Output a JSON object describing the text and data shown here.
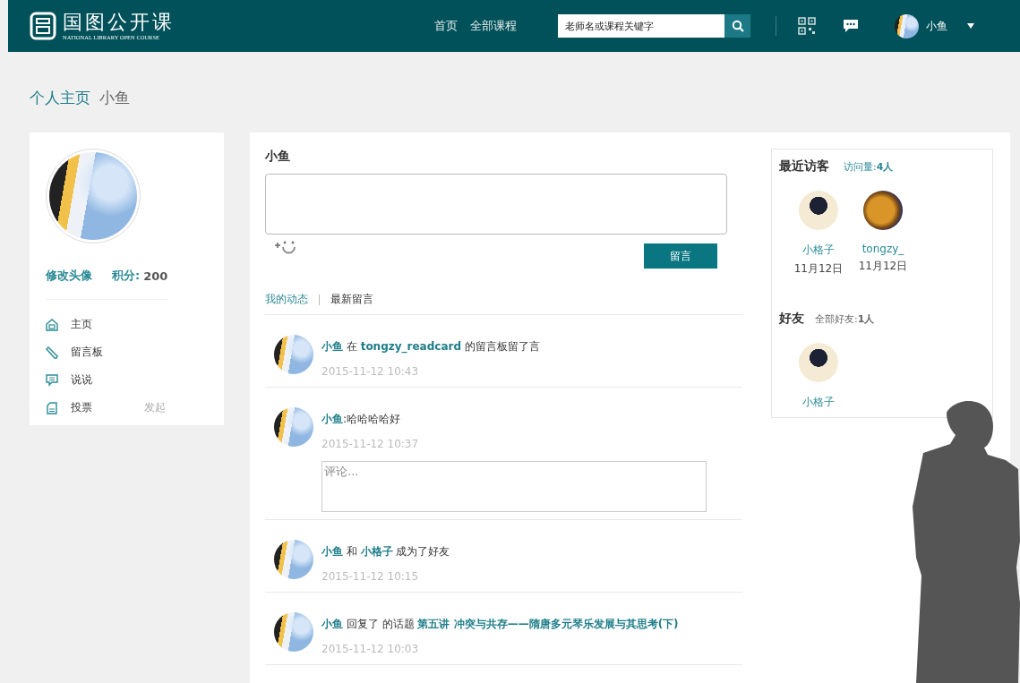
{
  "header": {
    "logo_title": "国图公开课",
    "logo_subtitle": "NATIONAL LIBRARY OPEN COURSE",
    "nav": [
      {
        "label": "首页"
      },
      {
        "label": "全部课程"
      }
    ],
    "search": {
      "placeholder": "老师名或课程关键字"
    },
    "user_name": "小鱼"
  },
  "breadcrumb": {
    "section": "个人主页",
    "name": "小鱼"
  },
  "profile": {
    "edit_avatar": "修改头像",
    "points_label": "积分:",
    "points": "200",
    "menu": [
      {
        "kind": "home",
        "label": "主页"
      },
      {
        "kind": "pencil",
        "label": "留言板"
      },
      {
        "kind": "chat",
        "label": "说说"
      },
      {
        "kind": "document",
        "label": "投票",
        "action": "发起"
      }
    ]
  },
  "message_box": {
    "title": "小鱼",
    "button": "留言"
  },
  "tabs": [
    {
      "label": "我的动态",
      "selected": true
    },
    {
      "label": "最新留言",
      "selected": false
    }
  ],
  "feed": [
    {
      "parts": [
        {
          "kind": "link",
          "text": "小鱼"
        },
        {
          "kind": "plain",
          "text": " 在 "
        },
        {
          "kind": "link",
          "text": "tongzy_readcard"
        },
        {
          "kind": "plain",
          "text": " 的留言板留了言"
        }
      ],
      "time": "2015-11-12 10:43"
    },
    {
      "parts": [
        {
          "kind": "link",
          "text": "小鱼"
        },
        {
          "kind": "plain",
          "text": ":哈哈哈哈好"
        }
      ],
      "time": "2015-11-12 10:37",
      "comment_placeholder": "评论..."
    },
    {
      "parts": [
        {
          "kind": "link",
          "text": "小鱼"
        },
        {
          "kind": "plain",
          "text": " 和 "
        },
        {
          "kind": "link",
          "text": "小格子"
        },
        {
          "kind": "plain",
          "text": " 成为了好友"
        }
      ],
      "time": "2015-11-12 10:15"
    },
    {
      "parts": [
        {
          "kind": "link",
          "text": "小鱼"
        },
        {
          "kind": "plain",
          "text": " 回复了 的话题 "
        },
        {
          "kind": "link",
          "text": "第五讲 冲突与共存——隋唐多元琴乐发展与其思考(下)"
        }
      ],
      "time": "2015-11-12 10:03"
    }
  ],
  "visitors": {
    "title": "最近访客",
    "count_label": "访问量:",
    "count": "4人",
    "people": [
      {
        "name": "小格子",
        "date": "11月12日",
        "kind": "cartoon"
      },
      {
        "name": "tongzy_",
        "date": "11月12日",
        "kind": "photo"
      }
    ]
  },
  "friends": {
    "title": "好友",
    "count_label": "全部好友:",
    "count": "1人",
    "people": [
      {
        "name": "小格子",
        "kind": "cartoon"
      }
    ]
  }
}
